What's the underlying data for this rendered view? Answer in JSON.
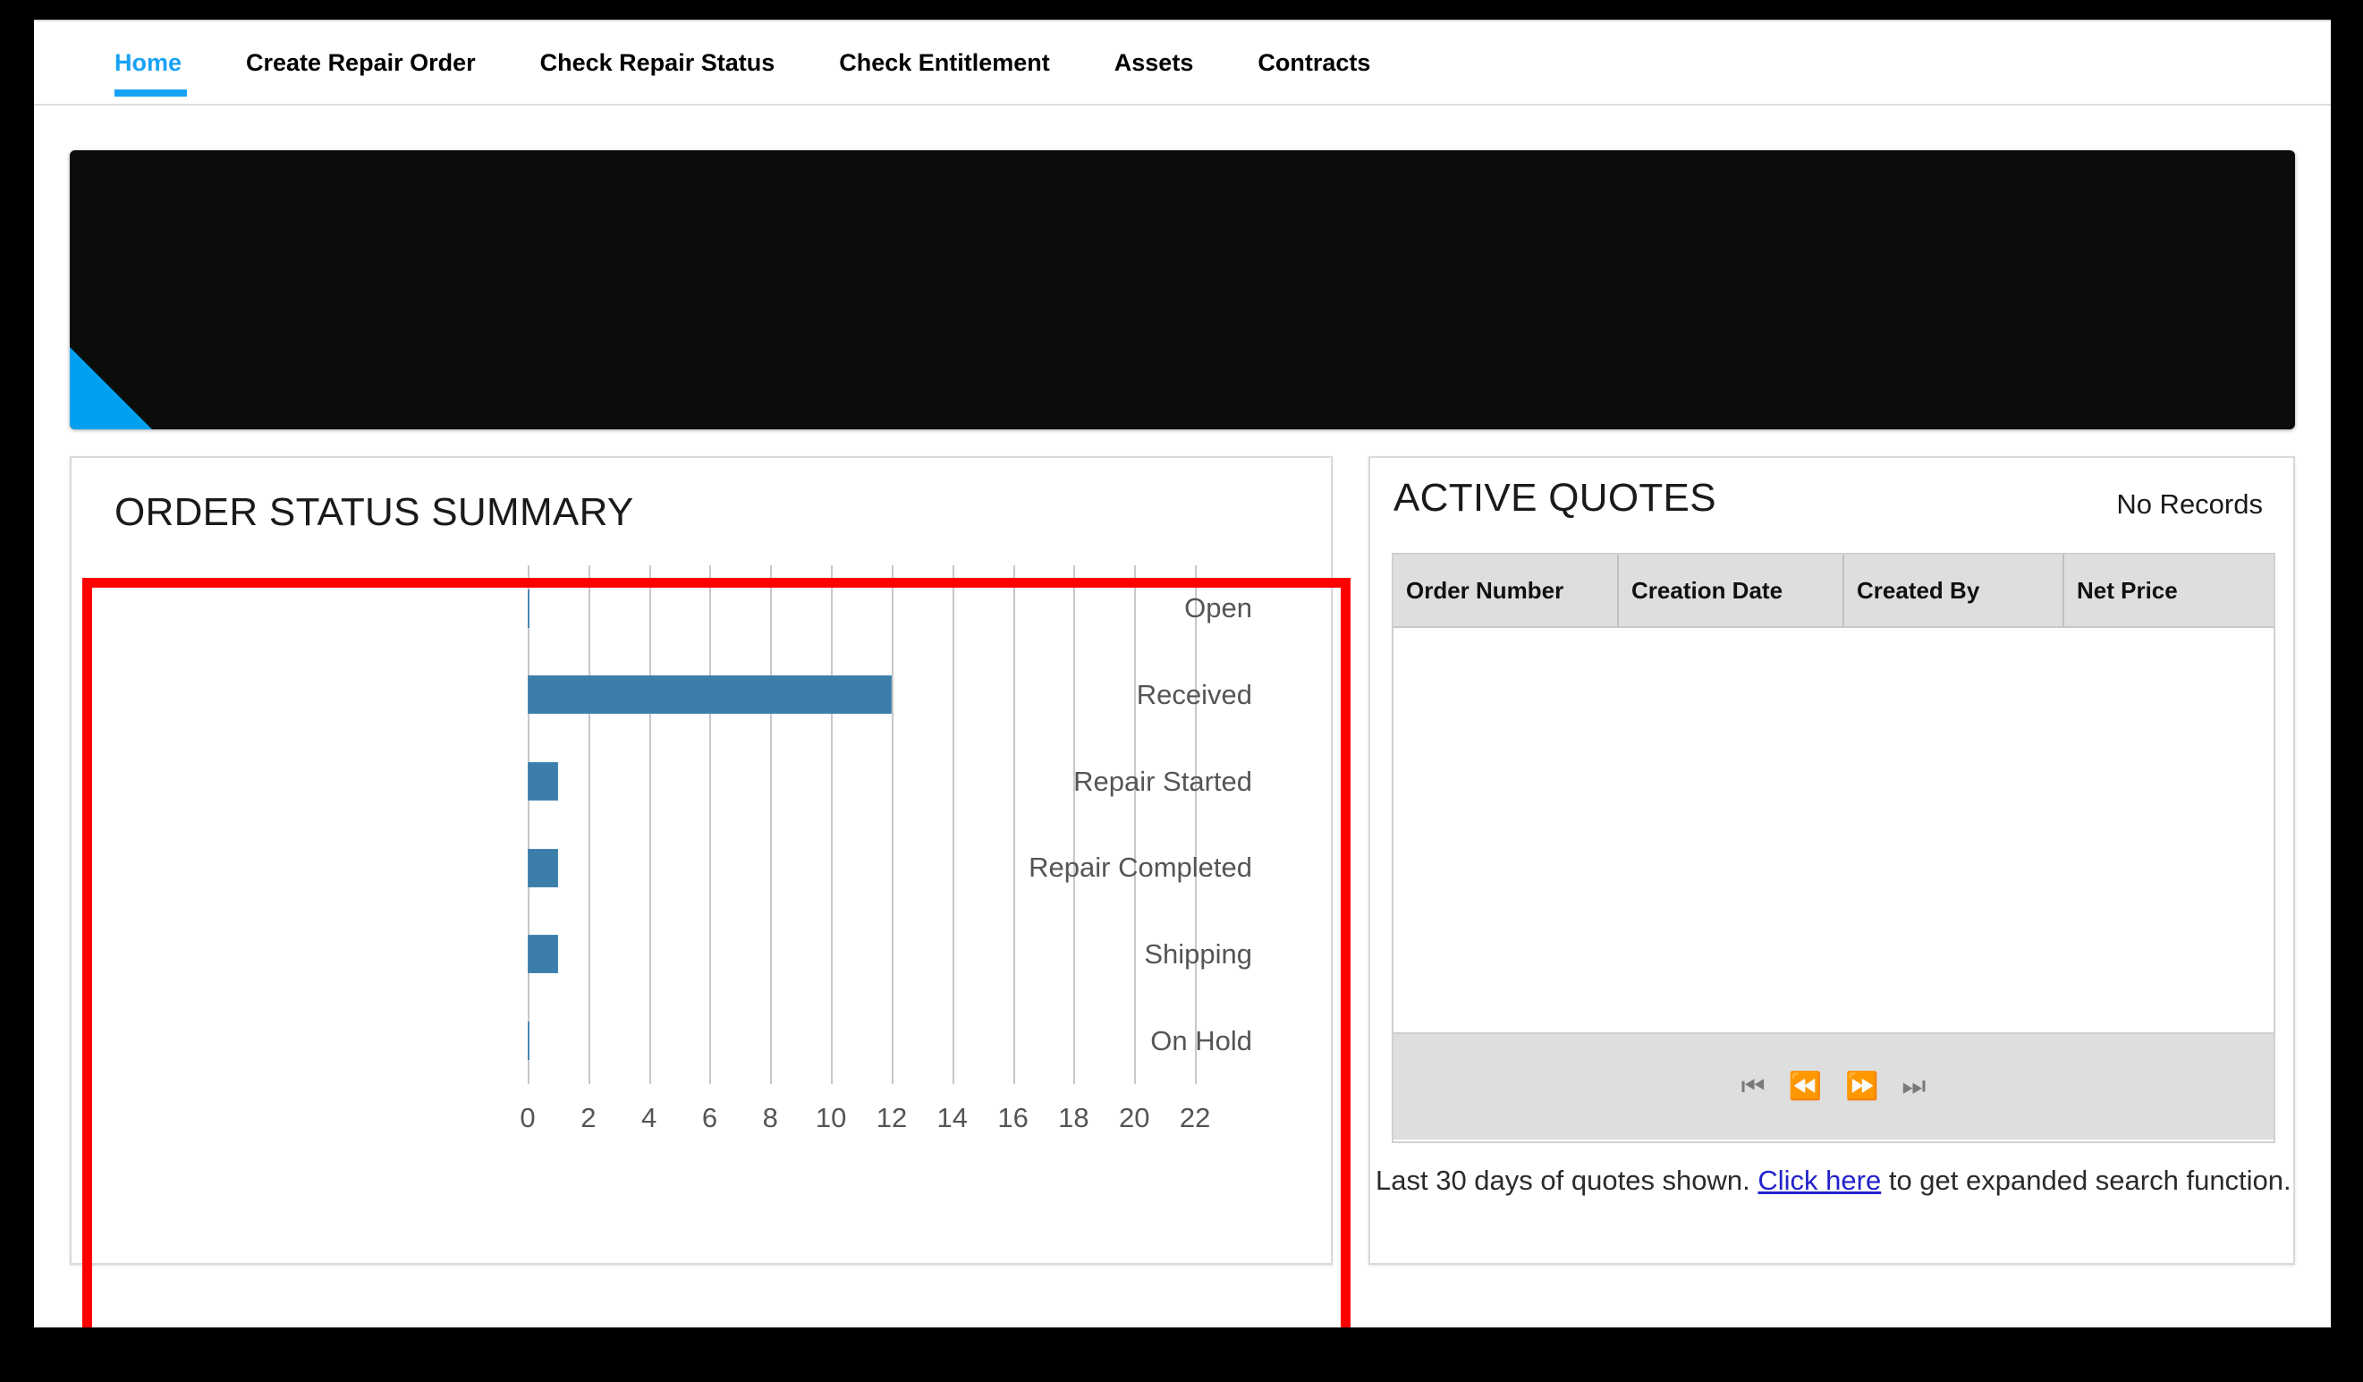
{
  "nav": {
    "items": [
      {
        "label": "Home",
        "active": true
      },
      {
        "label": "Create Repair Order",
        "active": false
      },
      {
        "label": "Check Repair Status",
        "active": false
      },
      {
        "label": "Check Entitlement",
        "active": false
      },
      {
        "label": "Assets",
        "active": false
      },
      {
        "label": "Contracts",
        "active": false
      }
    ]
  },
  "banner": {
    "accent_color": "#00A0F0",
    "background_color": "#0B0D0B"
  },
  "order_status": {
    "title": "ORDER STATUS SUMMARY",
    "highlight_color": "#FF0000"
  },
  "chart_data": {
    "type": "bar",
    "orientation": "horizontal",
    "title": "ORDER STATUS SUMMARY",
    "categories": [
      "Open",
      "Received",
      "Repair Started",
      "Repair Completed",
      "Shipping",
      "On Hold"
    ],
    "values": [
      0,
      12,
      1,
      1,
      1,
      0
    ],
    "xlabel": "",
    "ylabel": "",
    "xlim": [
      0,
      23
    ],
    "xticks": [
      0,
      2,
      4,
      6,
      8,
      10,
      12,
      14,
      16,
      18,
      20,
      22
    ],
    "tick_labels": [
      "0",
      "2",
      "4",
      "6",
      "8",
      "10",
      "12",
      "14",
      "16",
      "18",
      "20",
      "22"
    ],
    "grid": true,
    "grid_axis": "x",
    "bar_color": "#3C7EAA",
    "legend": null
  },
  "active_quotes": {
    "title": "ACTIVE QUOTES",
    "record_status": "No Records",
    "columns": [
      "Order Number",
      "Creation Date",
      "Created By",
      "Net Price"
    ],
    "rows": [],
    "pager": [
      {
        "name": "first-page",
        "glyph": "⏮"
      },
      {
        "name": "previous-page",
        "glyph": "⏪"
      },
      {
        "name": "next-page",
        "glyph": "⏩"
      },
      {
        "name": "last-page",
        "glyph": "⏭"
      }
    ],
    "footnote": {
      "before": "Last 30 days of quotes shown. ",
      "link": "Click here",
      "after": " to get expanded search function."
    }
  }
}
